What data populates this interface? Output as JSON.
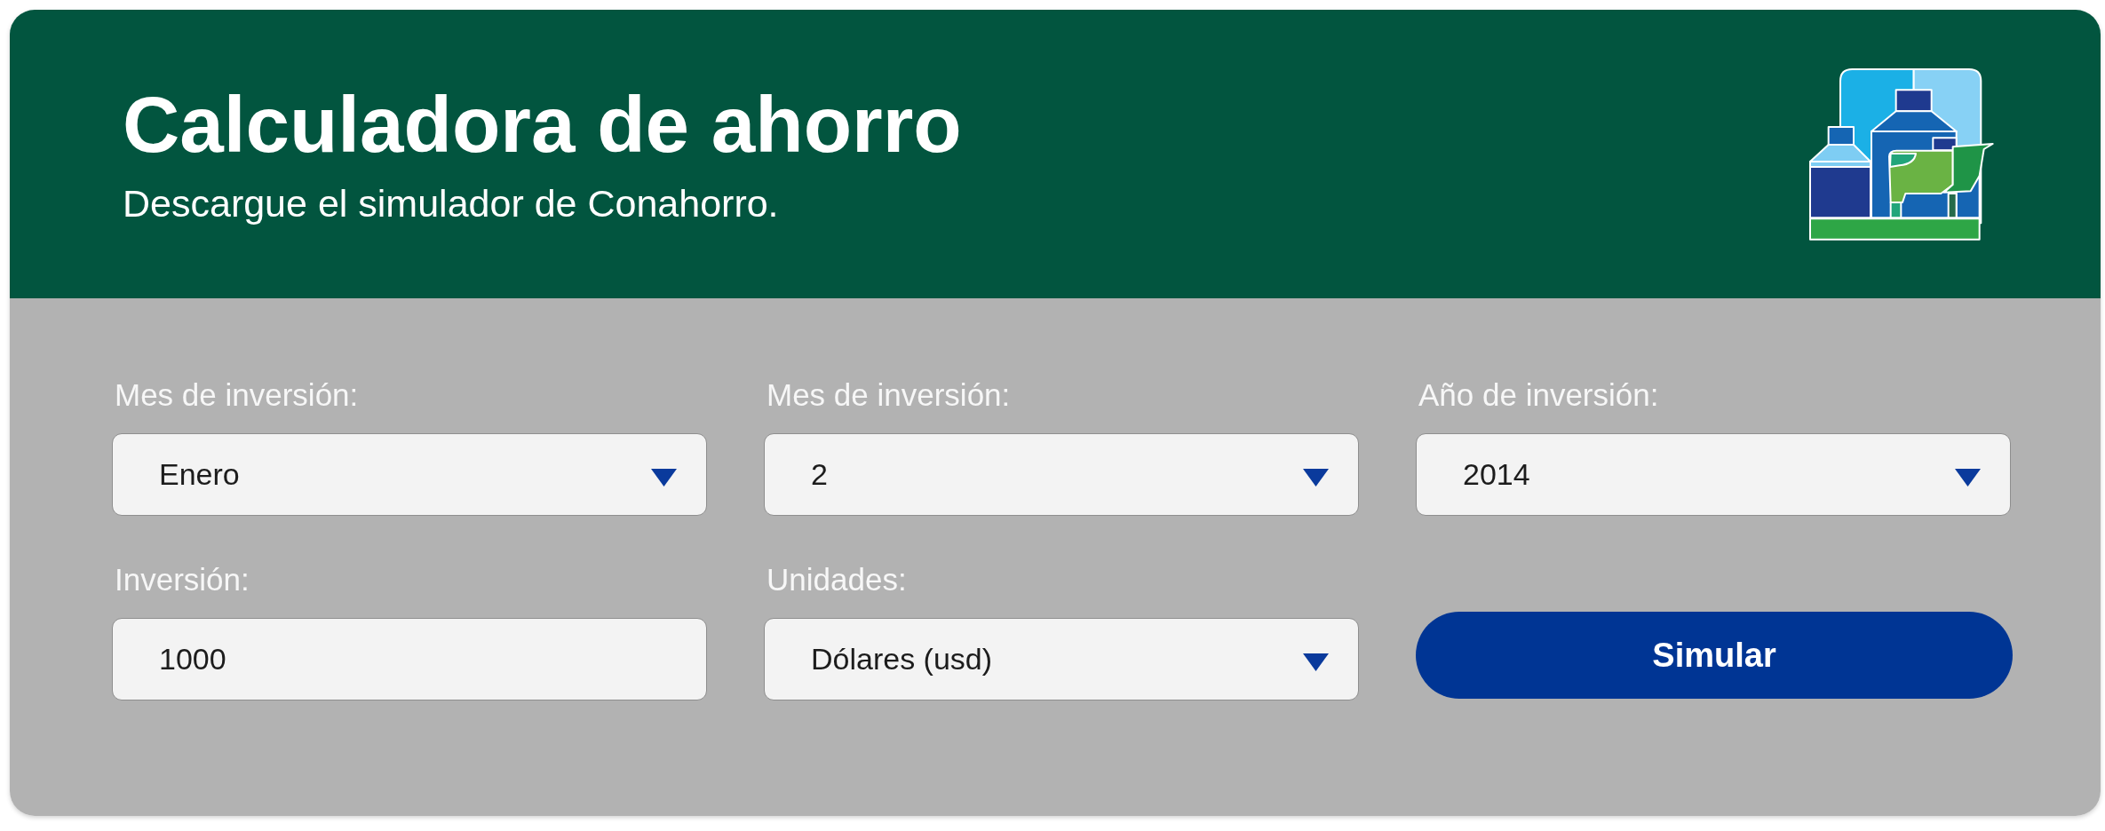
{
  "header": {
    "title": "Calculadora de ahorro",
    "subtitle": "Descargue el simulador de Conahorro."
  },
  "form": {
    "fields": [
      {
        "kind": "select",
        "label": "Mes de inversión:",
        "value": "Enero"
      },
      {
        "kind": "select",
        "label": "Mes de inversión:",
        "value": "2"
      },
      {
        "kind": "select",
        "label": "Año de inversión:",
        "value": "2014"
      },
      {
        "kind": "input",
        "label": "Inversión:",
        "value": "1000"
      },
      {
        "kind": "select",
        "label": "Unidades:",
        "value": "Dólares (usd)"
      }
    ],
    "submit": {
      "label": "Simular"
    }
  }
}
